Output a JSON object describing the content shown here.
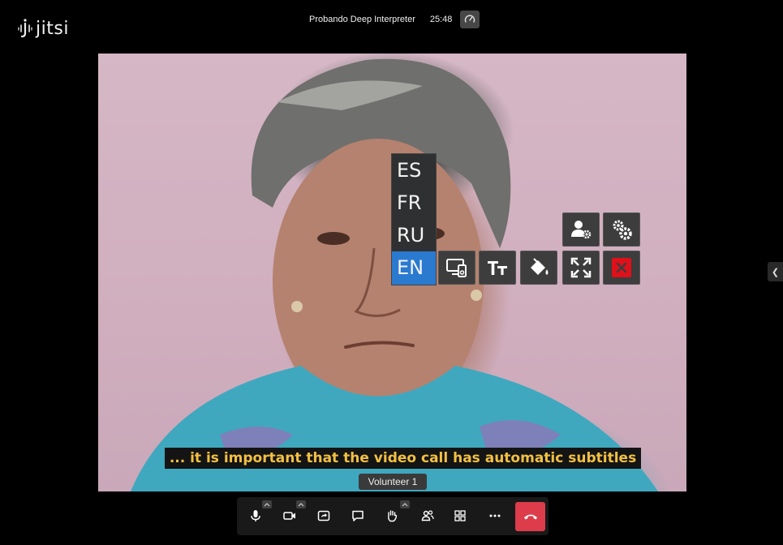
{
  "header": {
    "logo_text": "jitsi",
    "meeting_title": "Probando Deep Interpreter",
    "timer": "25:48"
  },
  "languages": {
    "items": [
      "ES",
      "FR",
      "RU",
      "EN"
    ],
    "selected": "EN"
  },
  "subtitle": "...  it is important that the video call has automatic subtitles",
  "participant_name": "Volunteer 1",
  "colors": {
    "accent": "#2a7ad0",
    "subtitle_text": "#f2c043",
    "hangup": "#dd3c4a",
    "close": "#e0101a"
  },
  "icons": {
    "header": [
      "jitsi-logo-icon",
      "performance-gauge-icon"
    ],
    "tools": [
      "user-settings-icon",
      "settings-icon",
      "screen-source-icon",
      "text-size-icon",
      "paint-bucket-icon",
      "fullscreen-icon",
      "close-icon"
    ],
    "toolbar": [
      "microphone-icon",
      "camera-icon",
      "screen-share-icon",
      "chat-icon",
      "raise-hand-icon",
      "participants-icon",
      "tile-view-icon",
      "more-icon",
      "hangup-icon"
    ]
  }
}
